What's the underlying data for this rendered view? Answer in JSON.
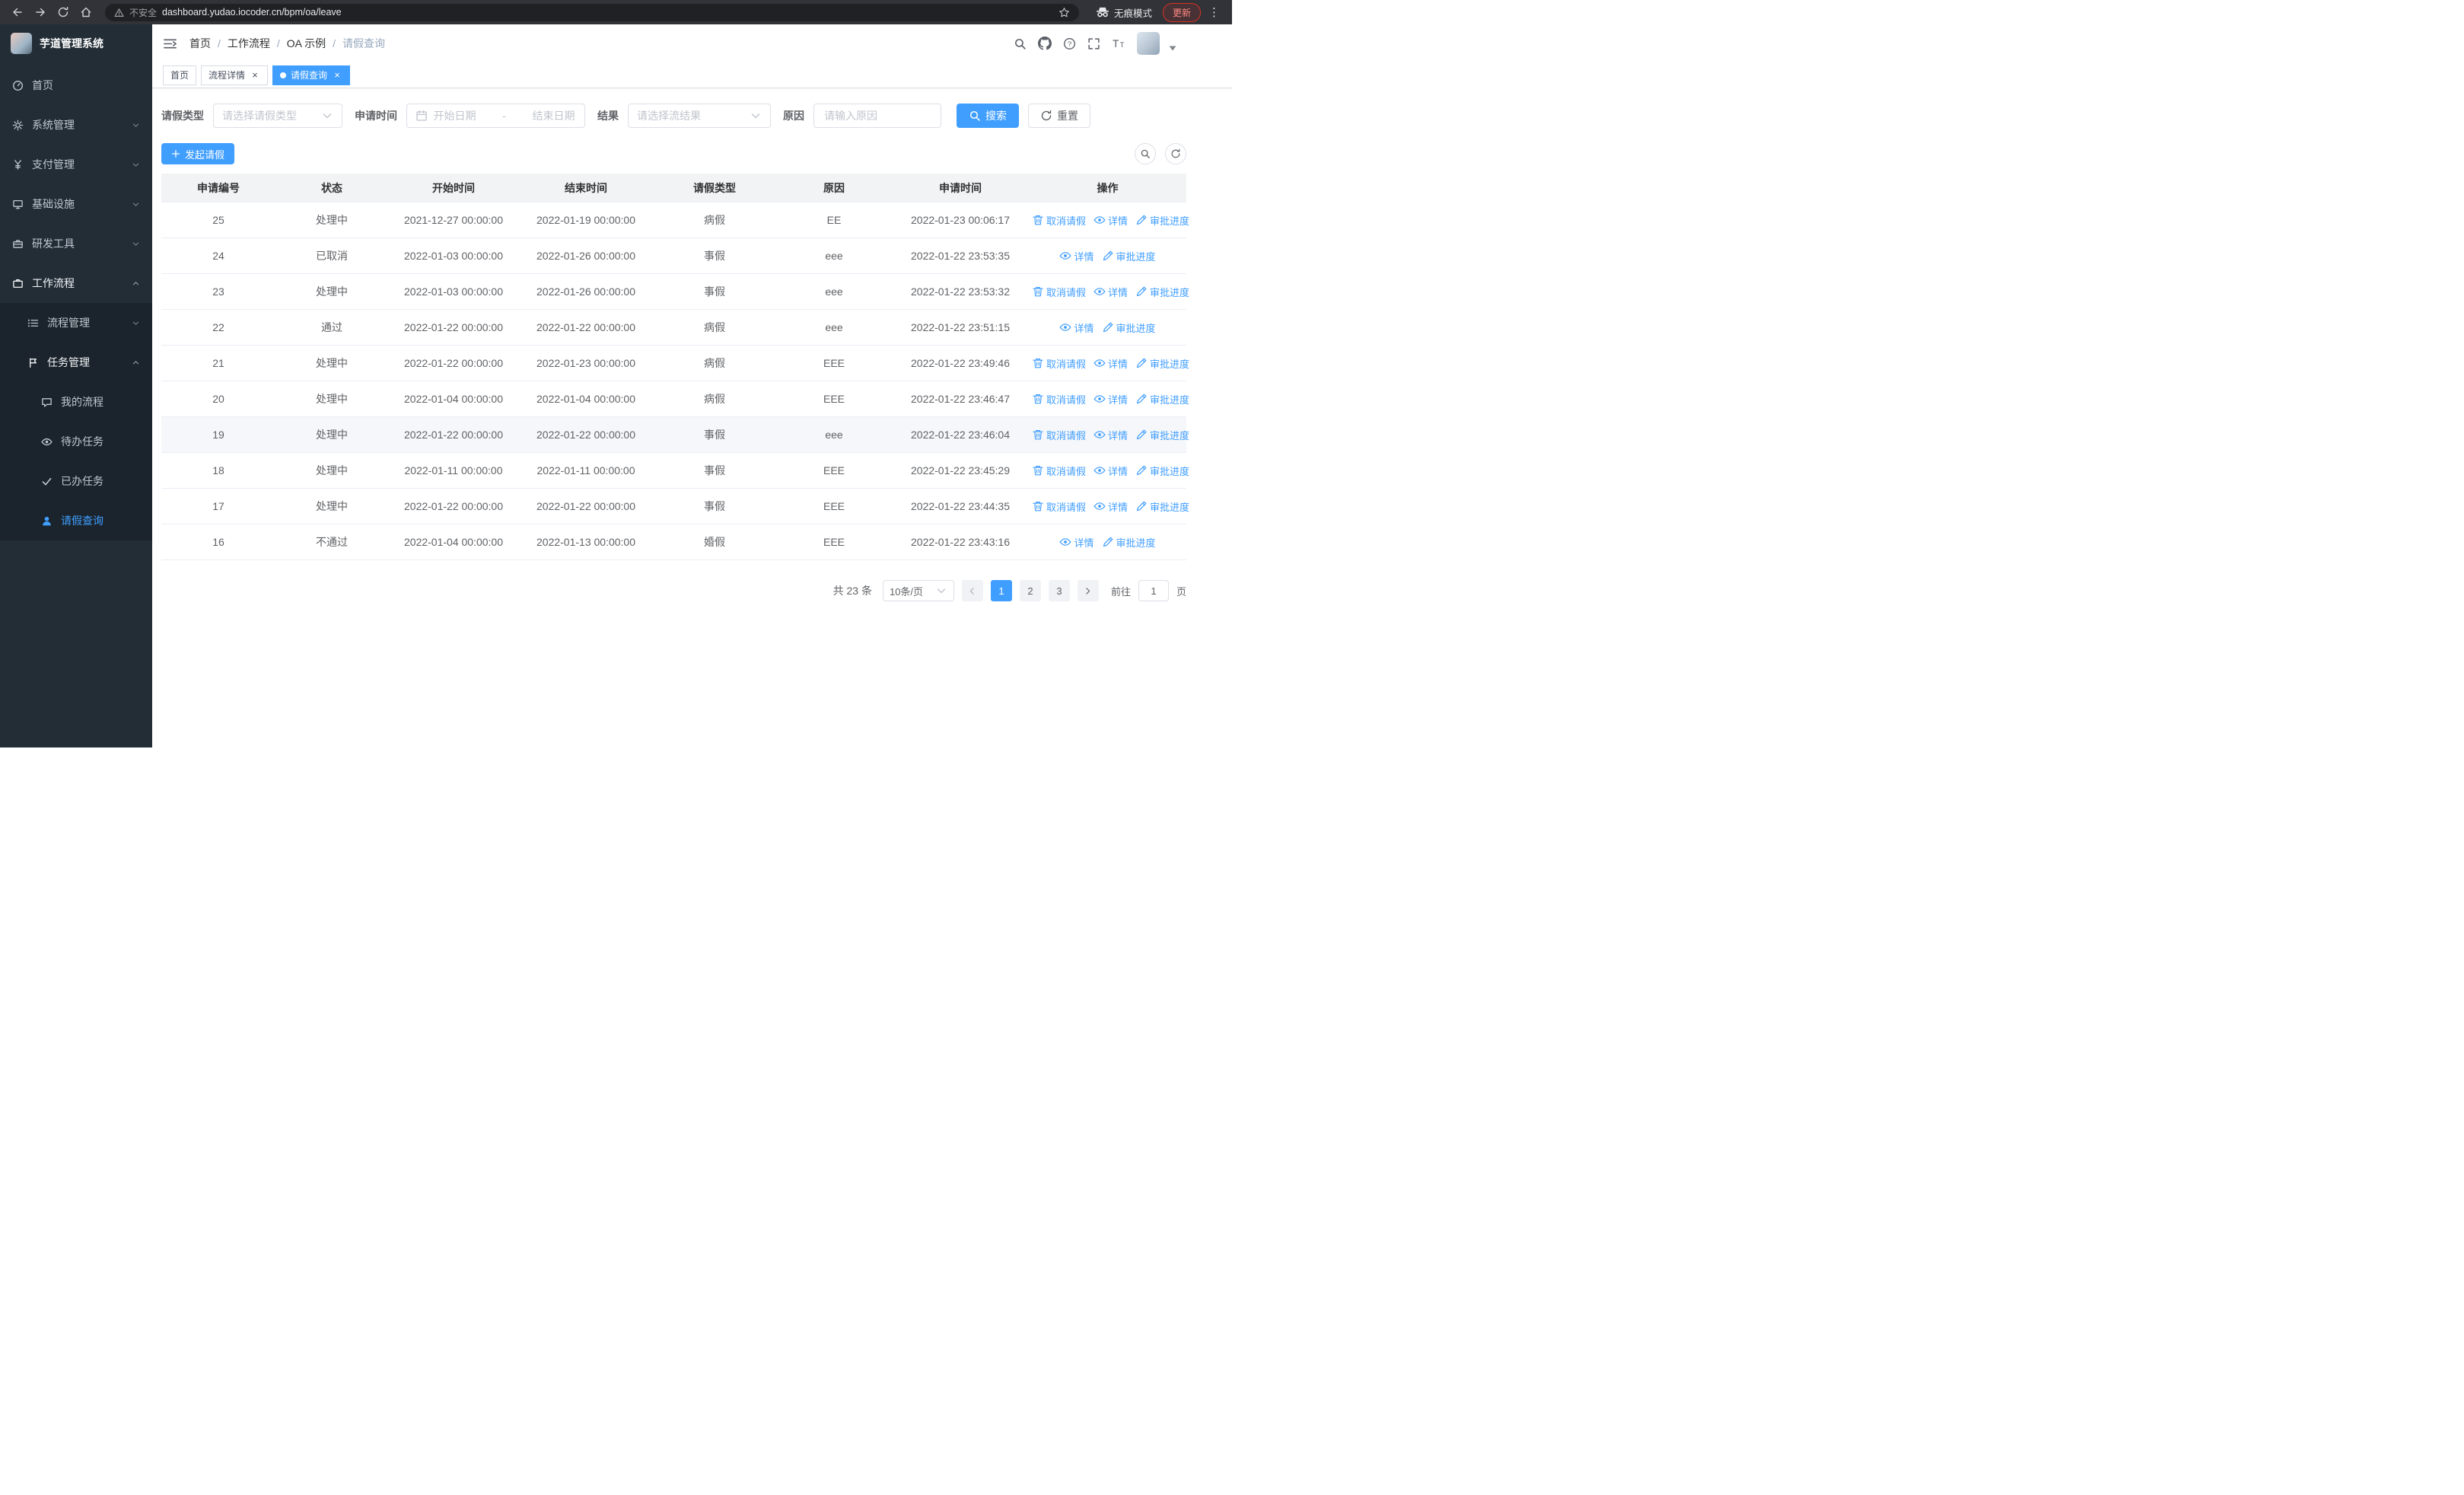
{
  "browser": {
    "security_label": "不安全",
    "url": "dashboard.yudao.iocoder.cn/bpm/oa/leave",
    "incognito_label": "无痕模式",
    "update_label": "更新"
  },
  "app": {
    "title": "芋道管理系统"
  },
  "colors": {
    "primary": "#409eff",
    "sidebar_bg": "#222d36",
    "submenu_bg": "#1b242c",
    "table_header_bg": "#f2f3f5"
  },
  "sidebar": {
    "items": [
      {
        "label": "首页",
        "icon": "dashboard",
        "level": 1,
        "chevron": null,
        "active": false,
        "open": false
      },
      {
        "label": "系统管理",
        "icon": "gear",
        "level": 1,
        "chevron": "down",
        "active": false,
        "open": false
      },
      {
        "label": "支付管理",
        "icon": "yen",
        "level": 1,
        "chevron": "down",
        "active": false,
        "open": false
      },
      {
        "label": "基础设施",
        "icon": "monitor",
        "level": 1,
        "chevron": "down",
        "active": false,
        "open": false
      },
      {
        "label": "研发工具",
        "icon": "toolbox",
        "level": 1,
        "chevron": "down",
        "active": false,
        "open": false
      },
      {
        "label": "工作流程",
        "icon": "briefcase",
        "level": 1,
        "chevron": "up",
        "active": false,
        "open": true
      },
      {
        "label": "流程管理",
        "icon": "list",
        "level": 2,
        "chevron": "down",
        "active": false,
        "open": false
      },
      {
        "label": "任务管理",
        "icon": "flag",
        "level": 2,
        "chevron": "up",
        "active": false,
        "open": true
      },
      {
        "label": "我的流程",
        "icon": "chat",
        "level": 3,
        "chevron": null,
        "active": false,
        "open": false
      },
      {
        "label": "待办任务",
        "icon": "eye",
        "level": 3,
        "chevron": null,
        "active": false,
        "open": false
      },
      {
        "label": "已办任务",
        "icon": "check",
        "level": 3,
        "chevron": null,
        "active": false,
        "open": false
      },
      {
        "label": "请假查询",
        "icon": "user",
        "level": 3,
        "chevron": null,
        "active": true,
        "open": false
      }
    ]
  },
  "header": {
    "separator": "/",
    "breadcrumb": [
      {
        "label": "首页",
        "current": false
      },
      {
        "label": "工作流程",
        "current": false
      },
      {
        "label": "OA 示例",
        "current": false
      },
      {
        "label": "请假查询",
        "current": true
      }
    ]
  },
  "tabs": [
    {
      "label": "首页",
      "closable": false,
      "active": false
    },
    {
      "label": "流程详情",
      "closable": true,
      "active": false
    },
    {
      "label": "请假查询",
      "closable": true,
      "active": true
    }
  ],
  "filters": {
    "leave_type": {
      "label": "请假类型",
      "placeholder": "请选择请假类型"
    },
    "apply_time": {
      "label": "申请时间",
      "start_placeholder": "开始日期",
      "separator": "-",
      "end_placeholder": "结束日期"
    },
    "result": {
      "label": "结果",
      "placeholder": "请选择流结果"
    },
    "reason": {
      "label": "原因",
      "placeholder": "请输入原因"
    },
    "search_label": "搜索",
    "reset_label": "重置"
  },
  "toolbar": {
    "create_label": "发起请假"
  },
  "table": {
    "columns": [
      "申请编号",
      "状态",
      "开始时间",
      "结束时间",
      "请假类型",
      "原因",
      "申请时间",
      "操作"
    ],
    "rows": [
      {
        "id": "25",
        "status": "处理中",
        "start_time": "2021-12-27 00:00:00",
        "end_time": "2022-01-19 00:00:00",
        "leave_type": "病假",
        "reason": "EE",
        "apply_time": "2022-01-23 00:06:17",
        "highlight": false,
        "actions": [
          {
            "label": "取消请假",
            "icon": "delete"
          },
          {
            "label": "详情",
            "icon": "view"
          },
          {
            "label": "审批进度",
            "icon": "edit"
          }
        ]
      },
      {
        "id": "24",
        "status": "已取消",
        "start_time": "2022-01-03 00:00:00",
        "end_time": "2022-01-26 00:00:00",
        "leave_type": "事假",
        "reason": "eee",
        "apply_time": "2022-01-22 23:53:35",
        "highlight": false,
        "actions": [
          {
            "label": "详情",
            "icon": "view"
          },
          {
            "label": "审批进度",
            "icon": "edit"
          }
        ]
      },
      {
        "id": "23",
        "status": "处理中",
        "start_time": "2022-01-03 00:00:00",
        "end_time": "2022-01-26 00:00:00",
        "leave_type": "事假",
        "reason": "eee",
        "apply_time": "2022-01-22 23:53:32",
        "highlight": false,
        "actions": [
          {
            "label": "取消请假",
            "icon": "delete"
          },
          {
            "label": "详情",
            "icon": "view"
          },
          {
            "label": "审批进度",
            "icon": "edit"
          }
        ]
      },
      {
        "id": "22",
        "status": "通过",
        "start_time": "2022-01-22 00:00:00",
        "end_time": "2022-01-22 00:00:00",
        "leave_type": "病假",
        "reason": "eee",
        "apply_time": "2022-01-22 23:51:15",
        "highlight": false,
        "actions": [
          {
            "label": "详情",
            "icon": "view"
          },
          {
            "label": "审批进度",
            "icon": "edit"
          }
        ]
      },
      {
        "id": "21",
        "status": "处理中",
        "start_time": "2022-01-22 00:00:00",
        "end_time": "2022-01-23 00:00:00",
        "leave_type": "病假",
        "reason": "EEE",
        "apply_time": "2022-01-22 23:49:46",
        "highlight": false,
        "actions": [
          {
            "label": "取消请假",
            "icon": "delete"
          },
          {
            "label": "详情",
            "icon": "view"
          },
          {
            "label": "审批进度",
            "icon": "edit"
          }
        ]
      },
      {
        "id": "20",
        "status": "处理中",
        "start_time": "2022-01-04 00:00:00",
        "end_time": "2022-01-04 00:00:00",
        "leave_type": "病假",
        "reason": "EEE",
        "apply_time": "2022-01-22 23:46:47",
        "highlight": false,
        "actions": [
          {
            "label": "取消请假",
            "icon": "delete"
          },
          {
            "label": "详情",
            "icon": "view"
          },
          {
            "label": "审批进度",
            "icon": "edit"
          }
        ]
      },
      {
        "id": "19",
        "status": "处理中",
        "start_time": "2022-01-22 00:00:00",
        "end_time": "2022-01-22 00:00:00",
        "leave_type": "事假",
        "reason": "eee",
        "apply_time": "2022-01-22 23:46:04",
        "highlight": true,
        "actions": [
          {
            "label": "取消请假",
            "icon": "delete"
          },
          {
            "label": "详情",
            "icon": "view"
          },
          {
            "label": "审批进度",
            "icon": "edit"
          }
        ]
      },
      {
        "id": "18",
        "status": "处理中",
        "start_time": "2022-01-11 00:00:00",
        "end_time": "2022-01-11 00:00:00",
        "leave_type": "事假",
        "reason": "EEE",
        "apply_time": "2022-01-22 23:45:29",
        "highlight": false,
        "actions": [
          {
            "label": "取消请假",
            "icon": "delete"
          },
          {
            "label": "详情",
            "icon": "view"
          },
          {
            "label": "审批进度",
            "icon": "edit"
          }
        ]
      },
      {
        "id": "17",
        "status": "处理中",
        "start_time": "2022-01-22 00:00:00",
        "end_time": "2022-01-22 00:00:00",
        "leave_type": "事假",
        "reason": "EEE",
        "apply_time": "2022-01-22 23:44:35",
        "highlight": false,
        "actions": [
          {
            "label": "取消请假",
            "icon": "delete"
          },
          {
            "label": "详情",
            "icon": "view"
          },
          {
            "label": "审批进度",
            "icon": "edit"
          }
        ]
      },
      {
        "id": "16",
        "status": "不通过",
        "start_time": "2022-01-04 00:00:00",
        "end_time": "2022-01-13 00:00:00",
        "leave_type": "婚假",
        "reason": "EEE",
        "apply_time": "2022-01-22 23:43:16",
        "highlight": false,
        "actions": [
          {
            "label": "详情",
            "icon": "view"
          },
          {
            "label": "审批进度",
            "icon": "edit"
          }
        ]
      }
    ]
  },
  "pagination": {
    "total_label": "共 23 条",
    "page_size_label": "10条/页",
    "pages": [
      "1",
      "2",
      "3"
    ],
    "active_page": "1",
    "goto_label": "前往",
    "goto_value": "1",
    "goto_suffix": "页"
  }
}
